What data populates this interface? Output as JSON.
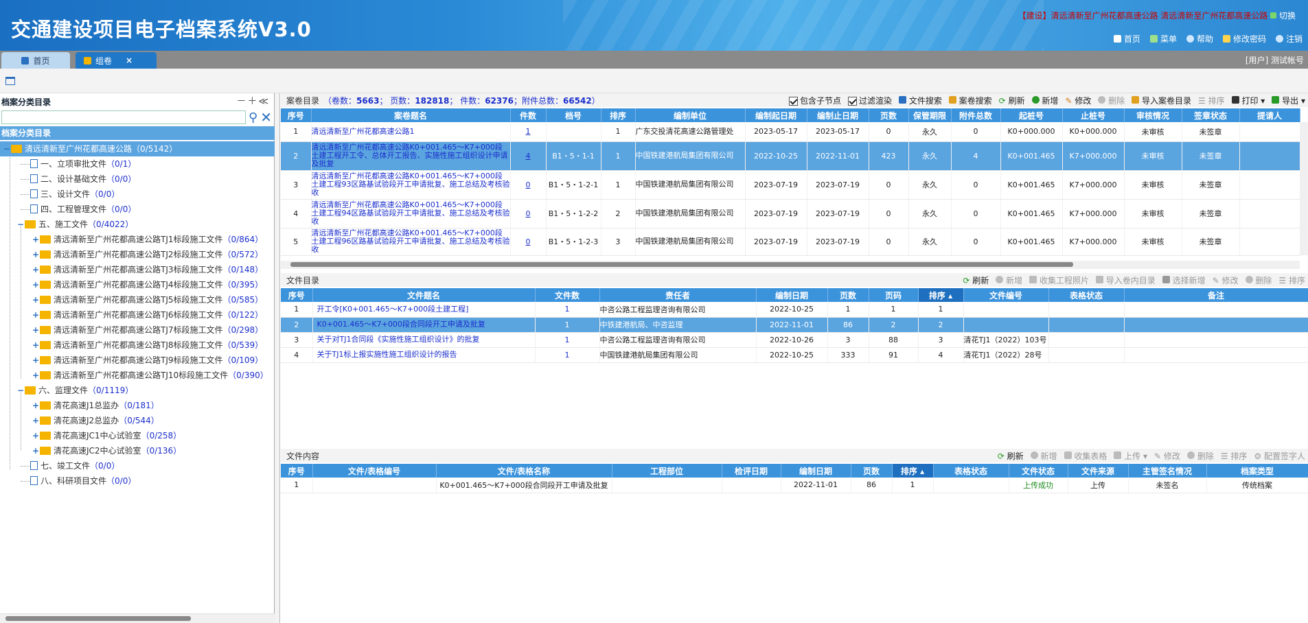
{
  "header": {
    "app_title": "交通建设项目电子档案系统V3.0",
    "project_line": "【建设】清远清新至广州花都高速公路 清远清新至广州花都高速公路",
    "switch_label": "切换",
    "nav": [
      {
        "label": "首页",
        "icon": "home-icon"
      },
      {
        "label": "菜单",
        "icon": "menu-grid-icon"
      },
      {
        "label": "帮助",
        "icon": "help-icon"
      },
      {
        "label": "修改密码",
        "icon": "lock-icon"
      },
      {
        "label": "注销",
        "icon": "logout-icon"
      }
    ]
  },
  "tabs": [
    {
      "label": "首页",
      "icon": "home-icon"
    },
    {
      "label": "组卷",
      "icon": "grid-icon",
      "close": "×"
    }
  ],
  "user_label": "[用户] 测试帐号",
  "left": {
    "title": "档案分类目录",
    "controls": "－＋≪",
    "tree_header": "档案分类目录",
    "nodes": [
      {
        "label": "清远清新至广州花都高速公路",
        "count": "（0/5142）"
      },
      {
        "label": "一、立项审批文件",
        "count": "（0/1）"
      },
      {
        "label": "二、设计基础文件",
        "count": "（0/0）"
      },
      {
        "label": "三、设计文件",
        "count": "（0/0）"
      },
      {
        "label": "四、工程管理文件",
        "count": "（0/0）"
      },
      {
        "label": "五、施工文件",
        "count": "（0/4022）"
      },
      {
        "label": "清远清新至广州花都高速公路TJ1标段施工文件",
        "count": "（0/864）"
      },
      {
        "label": "清远清新至广州花都高速公路TJ2标段施工文件",
        "count": "（0/572）"
      },
      {
        "label": "清远清新至广州花都高速公路TJ3标段施工文件",
        "count": "（0/148）"
      },
      {
        "label": "清远清新至广州花都高速公路TJ4标段施工文件",
        "count": "（0/395）"
      },
      {
        "label": "清远清新至广州花都高速公路TJ5标段施工文件",
        "count": "（0/585）"
      },
      {
        "label": "清远清新至广州花都高速公路TJ6标段施工文件",
        "count": "（0/122）"
      },
      {
        "label": "清远清新至广州花都高速公路TJ7标段施工文件",
        "count": "（0/298）"
      },
      {
        "label": "清远清新至广州花都高速公路TJ8标段施工文件",
        "count": "（0/539）"
      },
      {
        "label": "清远清新至广州花都高速公路TJ9标段施工文件",
        "count": "（0/109）"
      },
      {
        "label": "清远清新至广州花都高速公路TJ10标段施工文件",
        "count": "（0/390）"
      },
      {
        "label": "六、监理文件",
        "count": "（0/1119）"
      },
      {
        "label": "清花高速J1总监办",
        "count": "（0/181）"
      },
      {
        "label": "清花高速J2总监办",
        "count": "（0/544）"
      },
      {
        "label": "清花高速JC1中心试验室",
        "count": "（0/258）"
      },
      {
        "label": "清花高速JC2中心试验室",
        "count": "（0/136）"
      },
      {
        "label": "七、竣工文件",
        "count": "（0/0）"
      },
      {
        "label": "八、科研项目文件",
        "count": "（0/0）"
      }
    ]
  },
  "volume_panel": {
    "title": "案卷目录",
    "stats_prefix": "（卷数：",
    "vol_count": "5663",
    "pages_label": "；  页数：",
    "pages": "182818",
    "items_label": "；  件数：",
    "items": "62376",
    "attach_label": "；附件总数：",
    "attach": "66542",
    "stats_suffix": "）",
    "include_sub": "包含子节点",
    "filter_render": "过滤渲染",
    "tools": [
      "文件搜索",
      "案卷搜索",
      "刷新",
      "新增",
      "修改",
      "删除",
      "导入案卷目录",
      "排序",
      "打印",
      "导出"
    ],
    "columns": [
      "序号",
      "案卷题名",
      "件数",
      "档号",
      "排序",
      "编制单位",
      "编制起日期",
      "编制止日期",
      "页数",
      "保管期限",
      "附件总数",
      "起桩号",
      "止桩号",
      "审核情况",
      "签章状态",
      "提请人"
    ],
    "rows": [
      [
        "1",
        "清远清新至广州花都高速公路1",
        "1",
        "",
        "1",
        "广东交投清花高速公路管理处",
        "2023-05-17",
        "2023-05-17",
        "0",
        "永久",
        "0",
        "K0+000.000",
        "K0+000.000",
        "未审核",
        "未签章",
        ""
      ],
      [
        "2",
        "清远清新至广州花都高速公路K0+001.465～K7+000段土建工程开工令、总体开工报告、实施性施工组织设计申请及批复",
        "4",
        "B1・5・1-1",
        "1",
        "中国铁建港航局集团有限公司",
        "2022-10-25",
        "2022-11-01",
        "423",
        "永久",
        "4",
        "K0+001.465",
        "K7+000.000",
        "未审核",
        "未签章",
        ""
      ],
      [
        "3",
        "清远清新至广州花都高速公路K0+001.465～K7+000段土建工程93区路基试验段开工申请批复、施工总结及考核验收",
        "0",
        "B1・5・1-2-1",
        "1",
        "中国铁建港航局集团有限公司",
        "2023-07-19",
        "2023-07-19",
        "0",
        "永久",
        "0",
        "K0+001.465",
        "K7+000.000",
        "未审核",
        "未签章",
        ""
      ],
      [
        "4",
        "清远清新至广州花都高速公路K0+001.465～K7+000段土建工程94区路基试验段开工申请批复、施工总结及考核验收",
        "0",
        "B1・5・1-2-2",
        "2",
        "中国铁建港航局集团有限公司",
        "2023-07-19",
        "2023-07-19",
        "0",
        "永久",
        "0",
        "K0+001.465",
        "K7+000.000",
        "未审核",
        "未签章",
        ""
      ],
      [
        "5",
        "清远清新至广州花都高速公路K0+001.465～K7+000段土建工程96区路基试验段开工申请批复、施工总结及考核验收",
        "0",
        "B1・5・1-2-3",
        "3",
        "中国铁建港航局集团有限公司",
        "2023-07-19",
        "2023-07-19",
        "0",
        "永久",
        "0",
        "K0+001.465",
        "K7+000.000",
        "未审核",
        "未签章",
        ""
      ]
    ]
  },
  "file_panel": {
    "title": "文件目录",
    "tools": [
      "刷新",
      "新增",
      "收集工程照片",
      "导入卷内目录",
      "选择新增",
      "修改",
      "删除",
      "排序"
    ],
    "columns": [
      "序号",
      "文件题名",
      "文件数",
      "责任者",
      "编制日期",
      "页数",
      "页码",
      "排序",
      "文件编号",
      "表格状态",
      "备注"
    ],
    "rows": [
      [
        "1",
        "开工令[K0+001.465～K7+000段土建工程]",
        "1",
        "中咨公路工程监理咨询有限公司",
        "2022-10-25",
        "1",
        "1",
        "1",
        "",
        "",
        ""
      ],
      [
        "2",
        "K0+001.465～K7+000段合同段开工申请及批复",
        "1",
        "中铁建港航局、中咨监理",
        "2022-11-01",
        "86",
        "2",
        "2",
        "",
        "",
        ""
      ],
      [
        "3",
        "关于对TJ1合同段《实施性施工组织设计》的批复",
        "1",
        "中咨公路工程监理咨询有限公司",
        "2022-10-26",
        "3",
        "88",
        "3",
        "清花TJ1（2022）103号",
        "",
        ""
      ],
      [
        "4",
        "关于TJ1标上报实施性施工组织设计的报告",
        "1",
        "中国铁建港航局集团有限公司",
        "2022-10-25",
        "333",
        "91",
        "4",
        "清花TJ1（2022）28号",
        "",
        ""
      ]
    ]
  },
  "content_panel": {
    "title": "文件内容",
    "tools": [
      "刷新",
      "新增",
      "收集表格",
      "上传",
      "修改",
      "删除",
      "排序",
      "配置签字人"
    ],
    "columns": [
      "序号",
      "文件/表格编号",
      "文件/表格名称",
      "工程部位",
      "检评日期",
      "编制日期",
      "页数",
      "排序",
      "表格状态",
      "文件状态",
      "文件来源",
      "主管签名情况",
      "档案类型"
    ],
    "rows": [
      [
        "1",
        "",
        "K0+001.465～K7+000段合同段开工申请及批复",
        "",
        "",
        "2022-11-01",
        "86",
        "1",
        "",
        "上传成功",
        "上传",
        "未签名",
        "传统档案"
      ]
    ]
  },
  "colors": {
    "header_blue": "#2a8ad6",
    "grid_head": "#3b93dc",
    "selection": "#5aa4e0",
    "link": "#1a2ecc",
    "project_red": "#cc0000",
    "success_green": "#1c8a1c"
  }
}
